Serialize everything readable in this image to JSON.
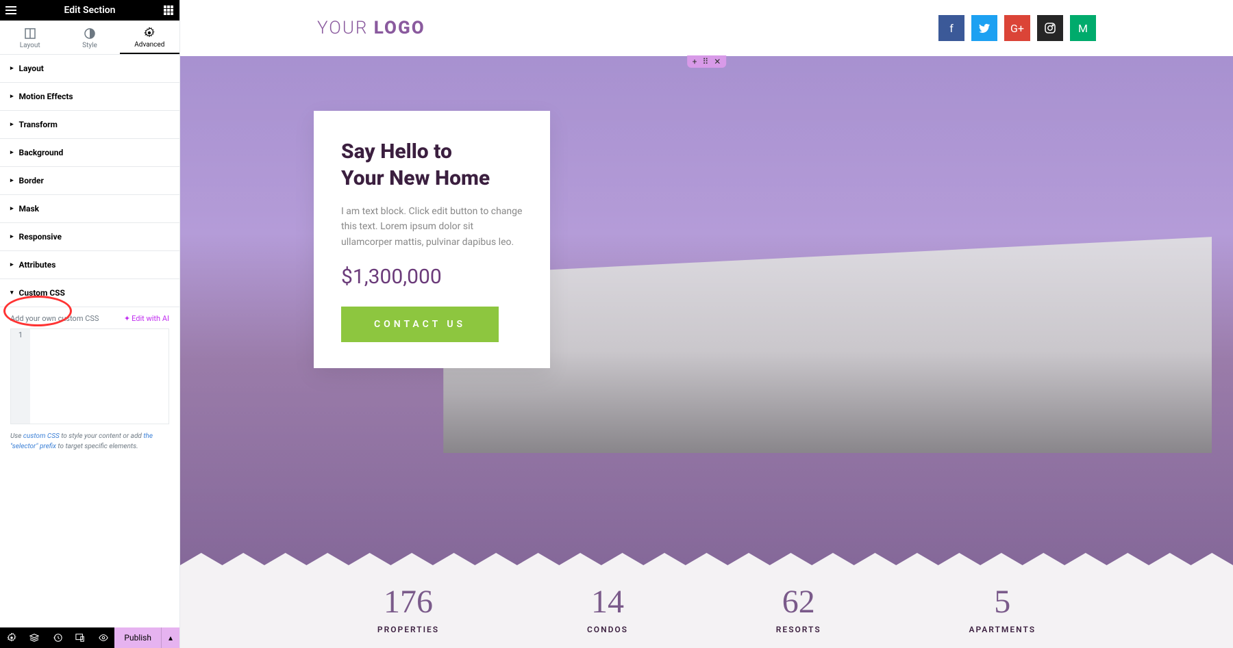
{
  "header": {
    "title": "Edit Section"
  },
  "tabs": {
    "layout": "Layout",
    "style": "Style",
    "advanced": "Advanced"
  },
  "accordions": [
    "Layout",
    "Motion Effects",
    "Transform",
    "Background",
    "Border",
    "Mask",
    "Responsive",
    "Attributes",
    "Custom CSS"
  ],
  "customCss": {
    "label": "Add your own custom CSS",
    "editAi": "Edit with AI",
    "line1": "1",
    "hintPre": "Use ",
    "hintLink1": "custom CSS",
    "hintMid": " to style your content or add ",
    "hintLink2": "the \"selector\" prefix",
    "hintEnd": " to target specific elements."
  },
  "footer": {
    "publish": "Publish"
  },
  "preview": {
    "logo_light": "YOUR ",
    "logo_bold": "LOGO",
    "card": {
      "title_l1": "Say Hello to",
      "title_l2": "Your New Home",
      "body": "I am text block. Click edit button to change this text. Lorem ipsum dolor sit ullamcorper mattis, pulvinar dapibus leo.",
      "price": "$1,300,000",
      "cta": "CONTACT US"
    },
    "stats": [
      {
        "num": "176",
        "lbl": "PROPERTIES"
      },
      {
        "num": "14",
        "lbl": "CONDOS"
      },
      {
        "num": "62",
        "lbl": "RESORTS"
      },
      {
        "num": "5",
        "lbl": "APARTMENTS"
      }
    ]
  }
}
